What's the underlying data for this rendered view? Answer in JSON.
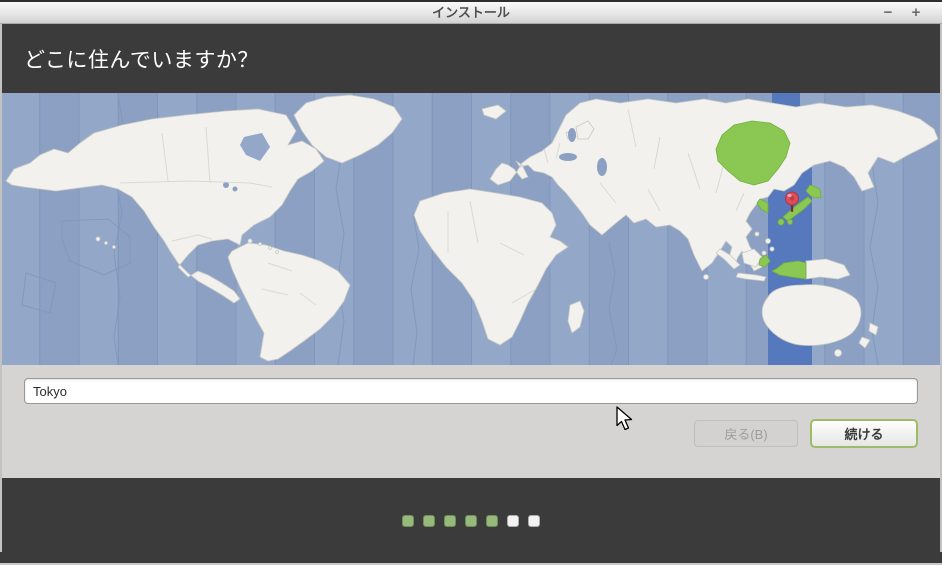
{
  "window": {
    "title": "インストール",
    "controls": {
      "minimize_glyph": "−",
      "maximize_glyph": "+"
    }
  },
  "header": {
    "question": "どこに住んでいますか？"
  },
  "map": {
    "kind": "world-timezone-map",
    "selected_region_marker": "red-pin-on-japan",
    "highlighted_regions": [
      "sakha-siberia",
      "korea",
      "japan",
      "west-new-guinea"
    ]
  },
  "form": {
    "city_value": "Tokyo"
  },
  "buttons": {
    "back": "戻る(B)",
    "continue": "続ける"
  },
  "progress": {
    "total": 7,
    "completed": 5
  },
  "theme": {
    "titlebar_text": "#4f4f4f",
    "header_bg": "#3b3b3b",
    "content_bg": "#d5d4d2",
    "ocean": "#93a8c8",
    "ocean_alt": "#8ba0c2",
    "ocean_line": "#8097bd",
    "band": "#5679bd",
    "land": "#f2f1ed",
    "land_border": "#c9c9c4",
    "highlight": "#8bc853",
    "highlight_border": "#72af3f",
    "pin": "#dc4f5a",
    "accent_green": "#9cbc6a",
    "dot_green": "#97b97c",
    "dot_white": "#f2f2f2"
  }
}
